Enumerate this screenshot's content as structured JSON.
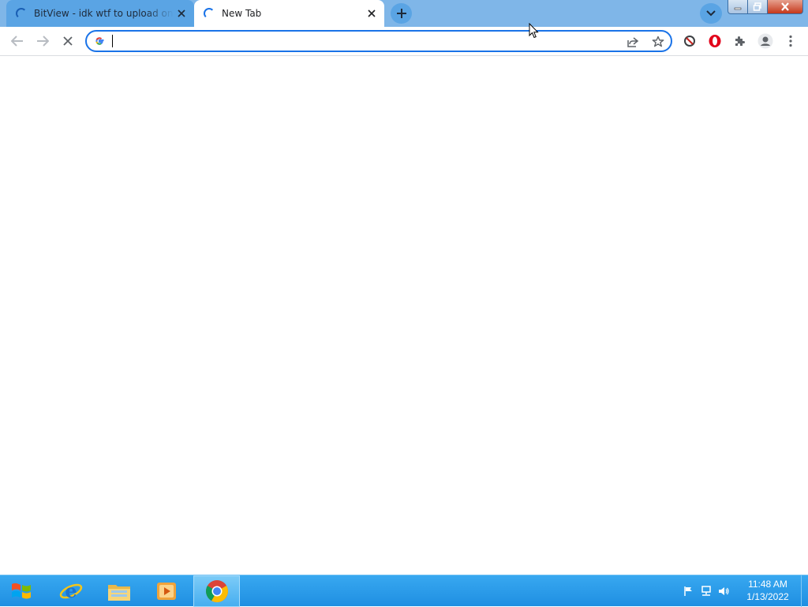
{
  "colors": {
    "tabstrip": "#7fb6e8",
    "active_tab": "#ffffff",
    "inactive_tab": "#5aa4e4",
    "omnibox_border": "#1a73e8",
    "taskbar": "#2a9be8"
  },
  "tabs": [
    {
      "title": "BitView - idk wtf to upload on bi",
      "loading": true,
      "active": false,
      "close_icon": "close-icon"
    },
    {
      "title": "New Tab",
      "loading": true,
      "active": true,
      "close_icon": "close-icon"
    }
  ],
  "toolbar": {
    "back_icon": "arrow-left-icon",
    "forward_icon": "arrow-right-icon",
    "stop_icon": "stop-icon",
    "omnibox": {
      "value": "",
      "placeholder": "",
      "provider_icon": "google-icon"
    },
    "share_icon": "share-icon",
    "bookmark_icon": "star-icon",
    "extensions": [
      "block-icon",
      "opera-icon",
      "puzzle-icon"
    ],
    "profile_icon": "profile-icon",
    "menu_icon": "kebab-menu-icon"
  },
  "taskbar": {
    "start_icon": "windows-logo-icon",
    "pinned": [
      "internet-explorer-icon",
      "file-explorer-icon",
      "media-player-icon",
      "chrome-icon"
    ],
    "tray_icons": [
      "flag-icon",
      "network-icon",
      "volume-icon"
    ],
    "clock": {
      "time": "11:48 AM",
      "date": "1/13/2022"
    }
  }
}
